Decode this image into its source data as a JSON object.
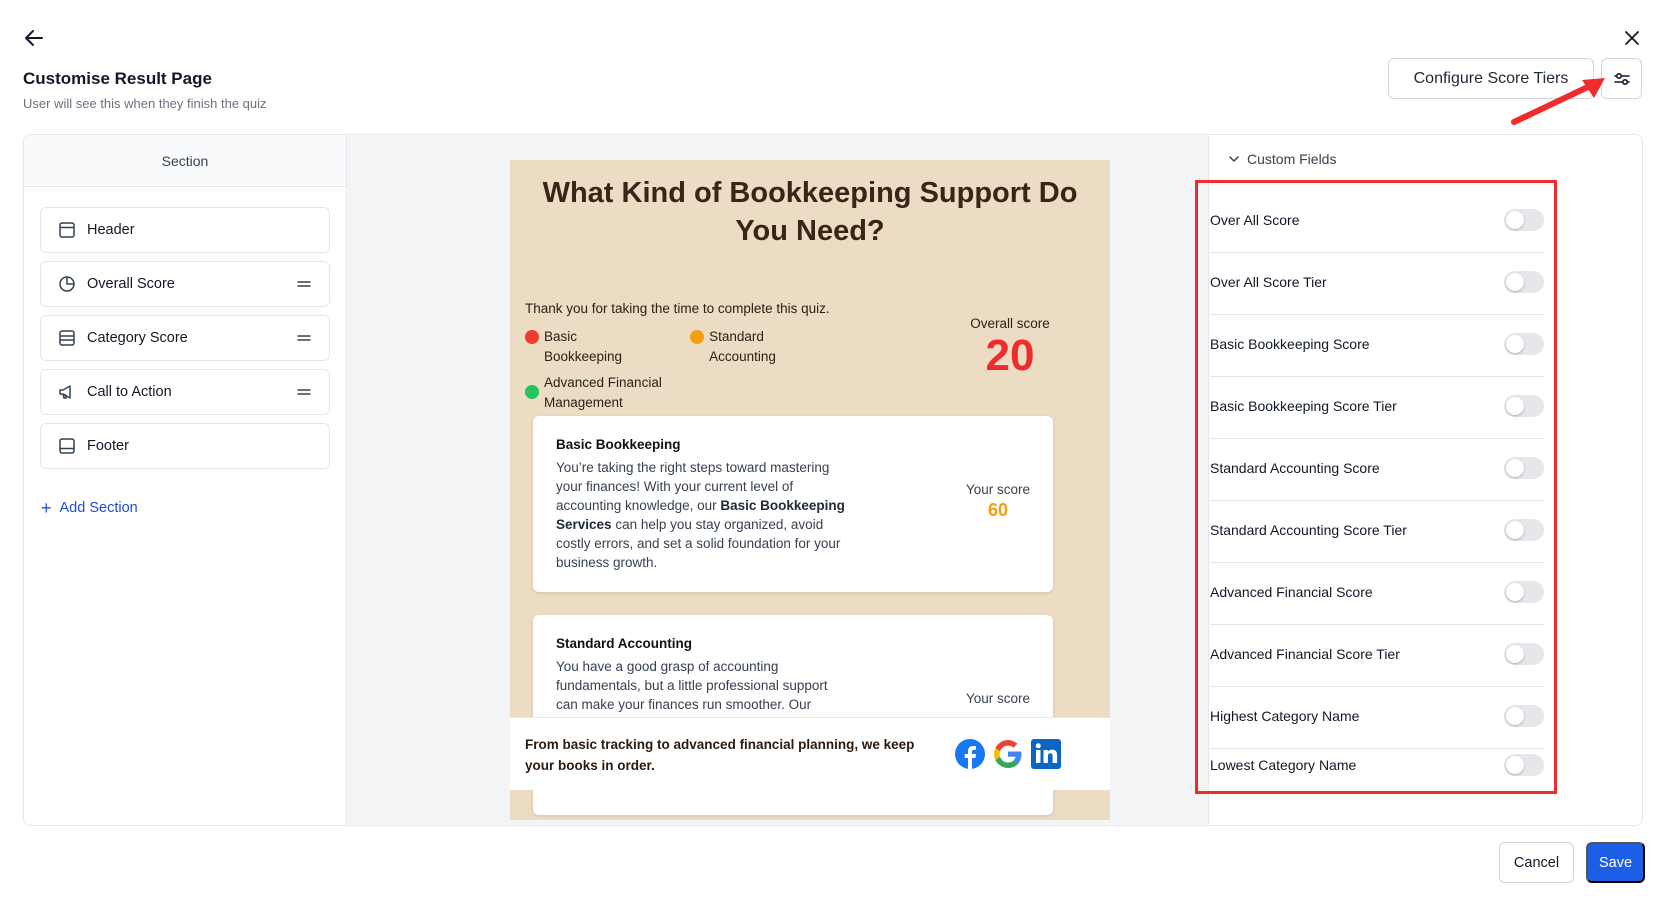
{
  "header": {
    "title": "Customise Result Page",
    "subtitle": "User will see this when they finish the quiz",
    "configure_label": "Configure Score Tiers"
  },
  "sidebar": {
    "heading": "Section",
    "items": [
      {
        "label": "Header",
        "icon": "layout-icon",
        "draggable": false
      },
      {
        "label": "Overall Score",
        "icon": "pie-chart-icon",
        "draggable": true
      },
      {
        "label": "Category Score",
        "icon": "list-icon",
        "draggable": true
      },
      {
        "label": "Call to Action",
        "icon": "megaphone-icon",
        "draggable": true
      },
      {
        "label": "Footer",
        "icon": "footer-layout-icon",
        "draggable": false
      }
    ],
    "add_label": "Add Section"
  },
  "preview": {
    "title": "What Kind of Bookkeeping Support Do You Need?",
    "thanks": "Thank you for taking the time to complete this quiz.",
    "legend": [
      {
        "label": "Basic Bookkeeping",
        "color": "#ef3b2d"
      },
      {
        "label": "Standard Accounting",
        "color": "#f59e0b"
      },
      {
        "label": "Advanced Financial Management",
        "color": "#22c55e"
      }
    ],
    "overall_label": "Overall score",
    "overall_value": "20",
    "categories": [
      {
        "name": "Basic Bookkeeping",
        "desc_pre": "You’re taking the right steps toward mastering your finances! With your current level of accounting knowledge, our ",
        "desc_bold": "Basic Bookkeeping Services",
        "desc_post": " can help you stay organized, avoid costly errors, and set a solid foundation for your business growth.",
        "score_label": "Your score",
        "score_value": "60"
      },
      {
        "name": "Standard Accounting",
        "desc_pre": "You have a good grasp of accounting fundamentals, but a little professional support can make your finances run smoother. Our",
        "desc_bold": "",
        "desc_post": "",
        "score_label": "Your score",
        "score_value": ""
      }
    ],
    "footer_text": "From basic tracking to advanced financial planning, we keep your books in order.",
    "social": [
      "facebook-icon",
      "google-icon",
      "linkedin-icon"
    ]
  },
  "custom_fields": {
    "heading": "Custom Fields",
    "fields": [
      {
        "label": "Over All Score",
        "enabled": false
      },
      {
        "label": "Over All Score Tier",
        "enabled": false
      },
      {
        "label": "Basic Bookkeeping Score",
        "enabled": false
      },
      {
        "label": "Basic Bookkeeping Score Tier",
        "enabled": false
      },
      {
        "label": "Standard Accounting Score",
        "enabled": false
      },
      {
        "label": "Standard Accounting Score Tier",
        "enabled": false
      },
      {
        "label": "Advanced Financial Score",
        "enabled": false
      },
      {
        "label": "Advanced Financial Score Tier",
        "enabled": false
      },
      {
        "label": "Highest Category Name",
        "enabled": false
      },
      {
        "label": "Lowest Category Name",
        "enabled": false
      }
    ]
  },
  "footer": {
    "cancel_label": "Cancel",
    "save_label": "Save"
  },
  "colors": {
    "primary": "#1d5ee6",
    "highlight": "#ef2b2b",
    "card_bg": "#ecdcc4"
  }
}
